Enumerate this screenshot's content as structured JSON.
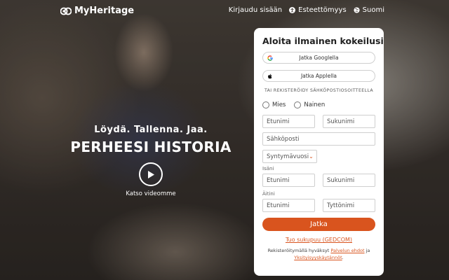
{
  "brand": {
    "name": "MyHeritage",
    "logo_icon": "myheritage-logo-icon"
  },
  "nav": {
    "login": "Kirjaudu sisään",
    "accessibility": "Esteettömyys",
    "language": "Suomi"
  },
  "hero": {
    "tagline": "Löydä. Tallenna. Jaa.",
    "headline": "PERHEESI HISTORIA",
    "video_label": "Katso videomme"
  },
  "signup": {
    "title": "Aloita ilmainen kokeilusi",
    "google": "Jatka Googlella",
    "apple": "Jatka Applella",
    "divider": "TAI REKISTERÖIDY SÄHKÖPOSTIOSOITTEELLA",
    "gender_male": "Mies",
    "gender_female": "Nainen",
    "first_name_ph": "Etunimi",
    "last_name_ph": "Sukunimi",
    "email_ph": "Sähköposti",
    "birth_year": "Syntymävuosi",
    "father_label": "Isäni",
    "father_first_ph": "Etunimi",
    "father_last_ph": "Sukunimi",
    "mother_label": "Äitini",
    "mother_first_ph": "Etunimi",
    "mother_maiden_ph": "Tyttönimi",
    "submit": "Jatka",
    "import_gedcom": "Tuo sukupuu (GEDCOM)",
    "legal_prefix": "Rekisteröitymällä hyväksyt ",
    "terms": "Palvelun ehdot",
    "legal_and": " ja",
    "privacy": "Yksityisyyskäytännöt",
    "legal_suffix": "."
  },
  "colors": {
    "accent": "#d9541e",
    "card_bg": "#ffffff"
  }
}
